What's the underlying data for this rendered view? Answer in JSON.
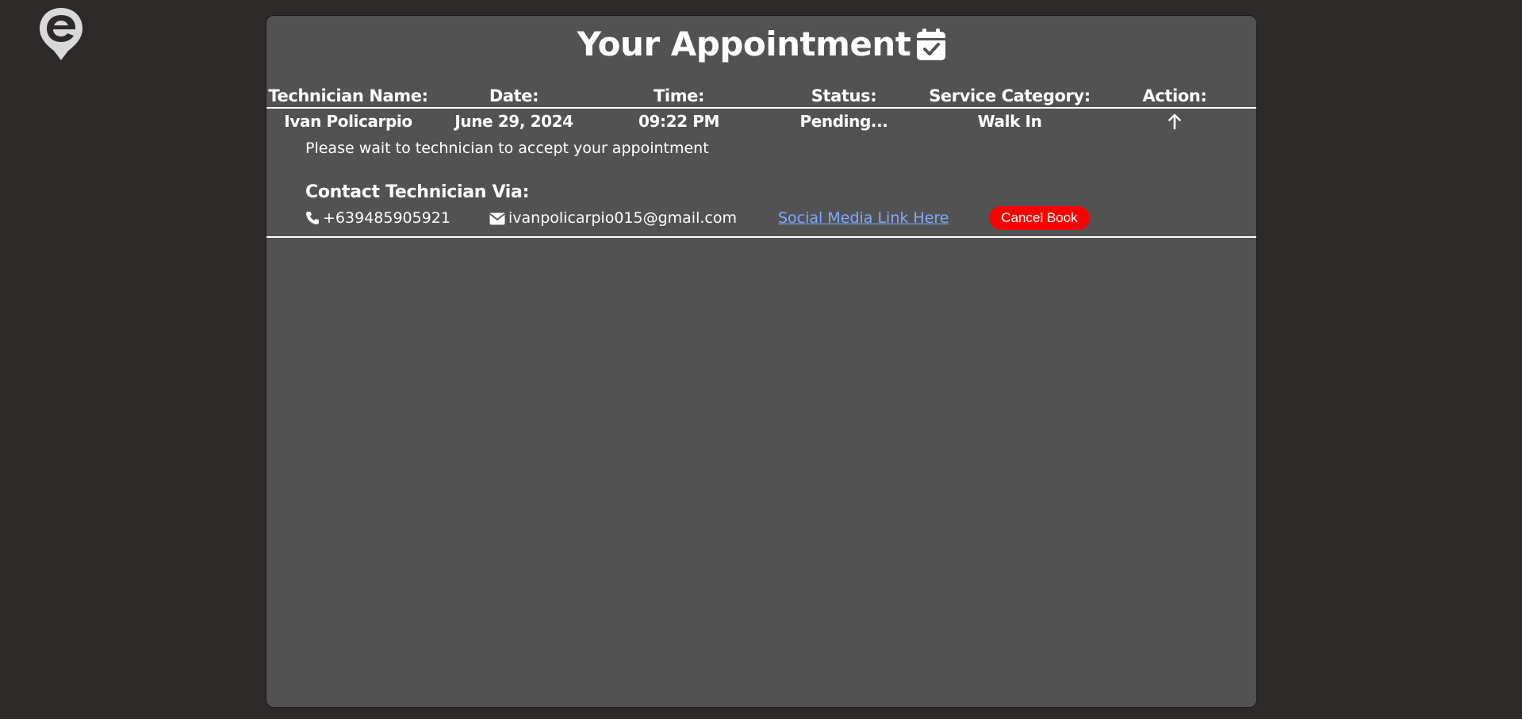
{
  "page": {
    "title": "Your Appointment",
    "title_icon": "calendar-check-icon",
    "logo_icon": "e-location-pin-logo-icon"
  },
  "table": {
    "headers": {
      "technician": "Technician Name:",
      "date": "Date:",
      "time": "Time:",
      "status": "Status:",
      "category": "Service Category:",
      "action": "Action:"
    },
    "row": {
      "technician": "Ivan Policarpio",
      "date": "June 29, 2024",
      "time": "09:22 PM",
      "status": "Pending...",
      "category": "Walk In",
      "action_icon": "arrow-up-icon"
    }
  },
  "details": {
    "message": "Please wait to technician to accept your appointment",
    "contact_title": "Contact Technician Via:",
    "phone": "+639485905921",
    "email": "ivanpolicarpio015@gmail.com",
    "social_link": "Social Media Link Here",
    "cancel_label": "Cancel Book"
  },
  "colors": {
    "background": "#2d2929",
    "panel": "#535253",
    "link": "#7fa9ff",
    "cancel": "#fc0000"
  }
}
